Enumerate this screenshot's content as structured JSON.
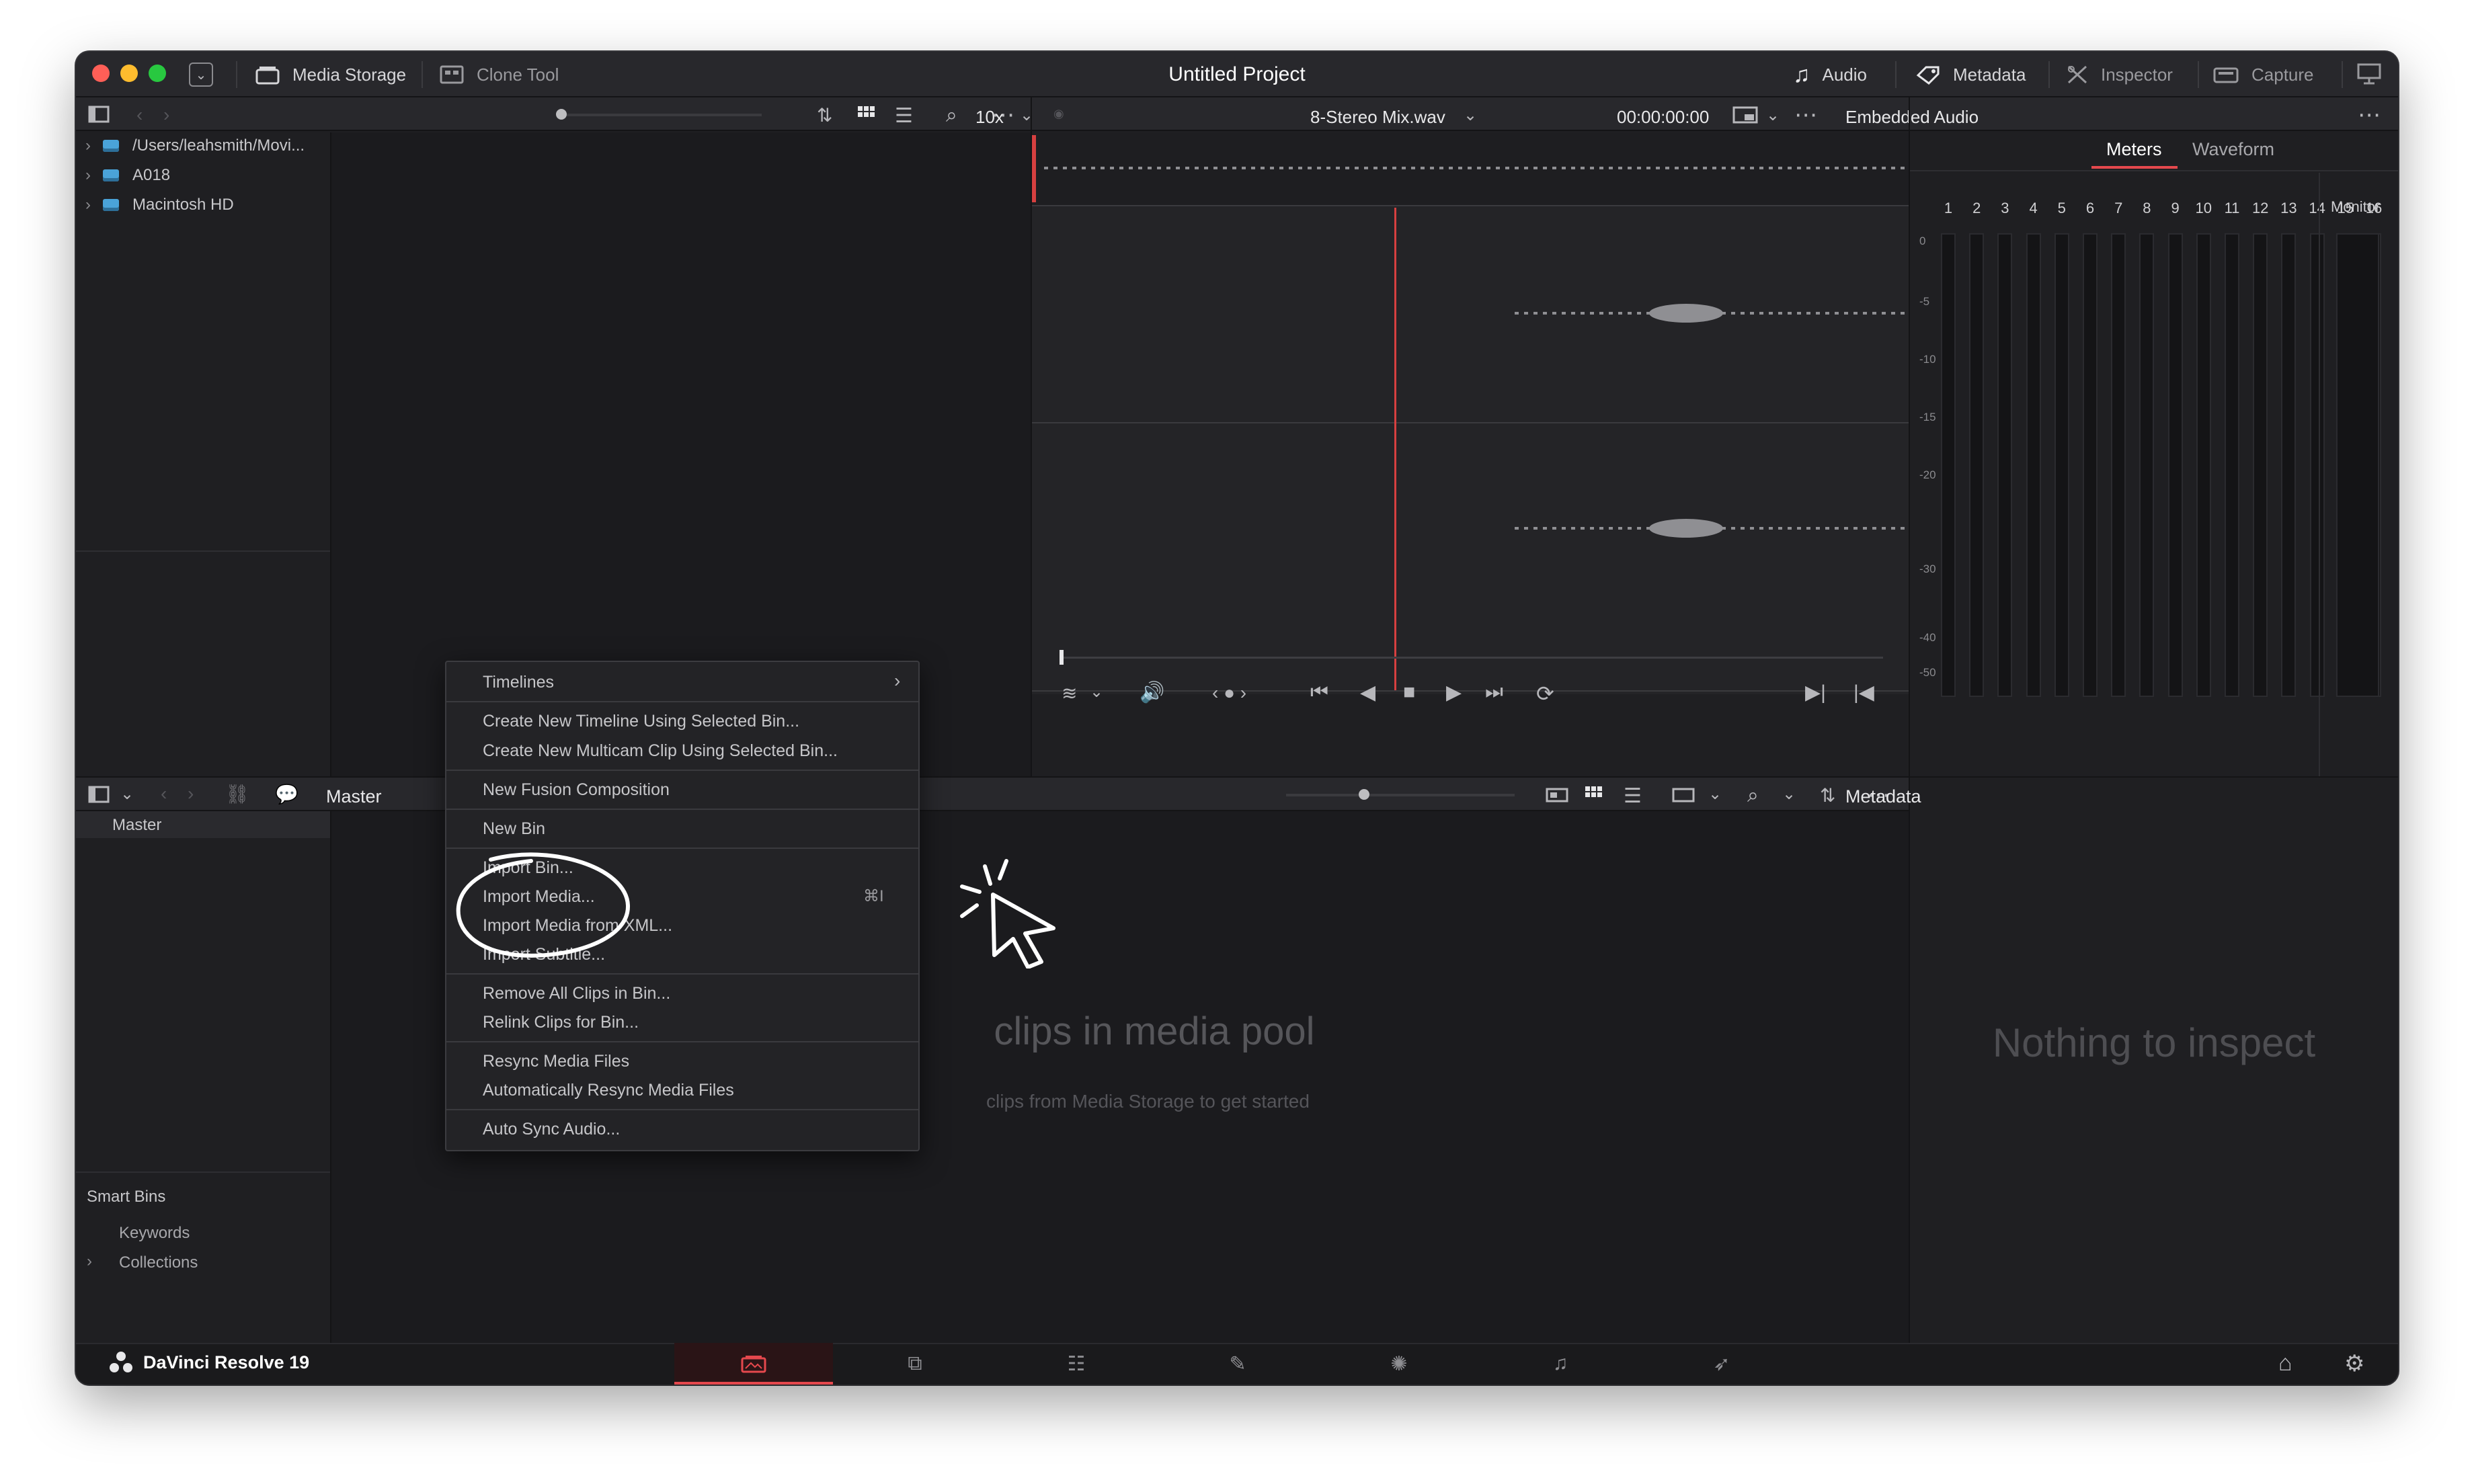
{
  "titlebar": {
    "project_title": "Untitled Project",
    "media_storage": "Media Storage",
    "clone_tool": "Clone Tool",
    "audio": "Audio",
    "metadata": "Metadata",
    "inspector": "Inspector",
    "capture": "Capture"
  },
  "storage": {
    "items": [
      "/Users/leahsmith/Movi...",
      "A018",
      "Macintosh HD"
    ]
  },
  "viewer": {
    "zoom": "10x",
    "clip_name": "8-Stereo Mix.wav",
    "timecode": "00:00:00:00"
  },
  "audio_panel": {
    "title": "Embedded Audio",
    "tab_meters": "Meters",
    "tab_waveform": "Waveform",
    "channels": [
      "1",
      "2",
      "3",
      "4",
      "5",
      "6",
      "7",
      "8",
      "9",
      "10",
      "11",
      "12",
      "13",
      "14",
      "15",
      "16"
    ],
    "monitor_label": "Monitor",
    "db_marks": [
      "0",
      "-5",
      "-10",
      "-15",
      "-20",
      "-30",
      "-40",
      "-50"
    ]
  },
  "pool": {
    "bin_title": "Master",
    "master_item": "Master",
    "smart_bins": "Smart Bins",
    "keywords": "Keywords",
    "collections": "Collections",
    "empty_title": "clips in media pool",
    "empty_sub": "clips from Media Storage to get started"
  },
  "metadata_panel": {
    "title": "Metadata",
    "empty": "Nothing to inspect"
  },
  "context_menu": {
    "timelines": "Timelines",
    "create_timeline": "Create New Timeline Using Selected Bin...",
    "create_multicam": "Create New Multicam Clip Using Selected Bin...",
    "new_fusion": "New Fusion Composition",
    "new_bin": "New Bin",
    "import_bin": "Import Bin...",
    "import_media": "Import Media...",
    "import_media_shortcut": "⌘I",
    "import_xml": "Import Media from XML...",
    "import_subtitle": "Import Subtitle...",
    "remove_all": "Remove All Clips in Bin...",
    "relink": "Relink Clips for Bin...",
    "resync": "Resync Media Files",
    "auto_resync": "Automatically Resync Media Files",
    "auto_sync_audio": "Auto Sync Audio..."
  },
  "footer": {
    "app_name": "DaVinci Resolve 19"
  },
  "colors": {
    "accent": "#e5484d",
    "playhead": "#d64040"
  }
}
